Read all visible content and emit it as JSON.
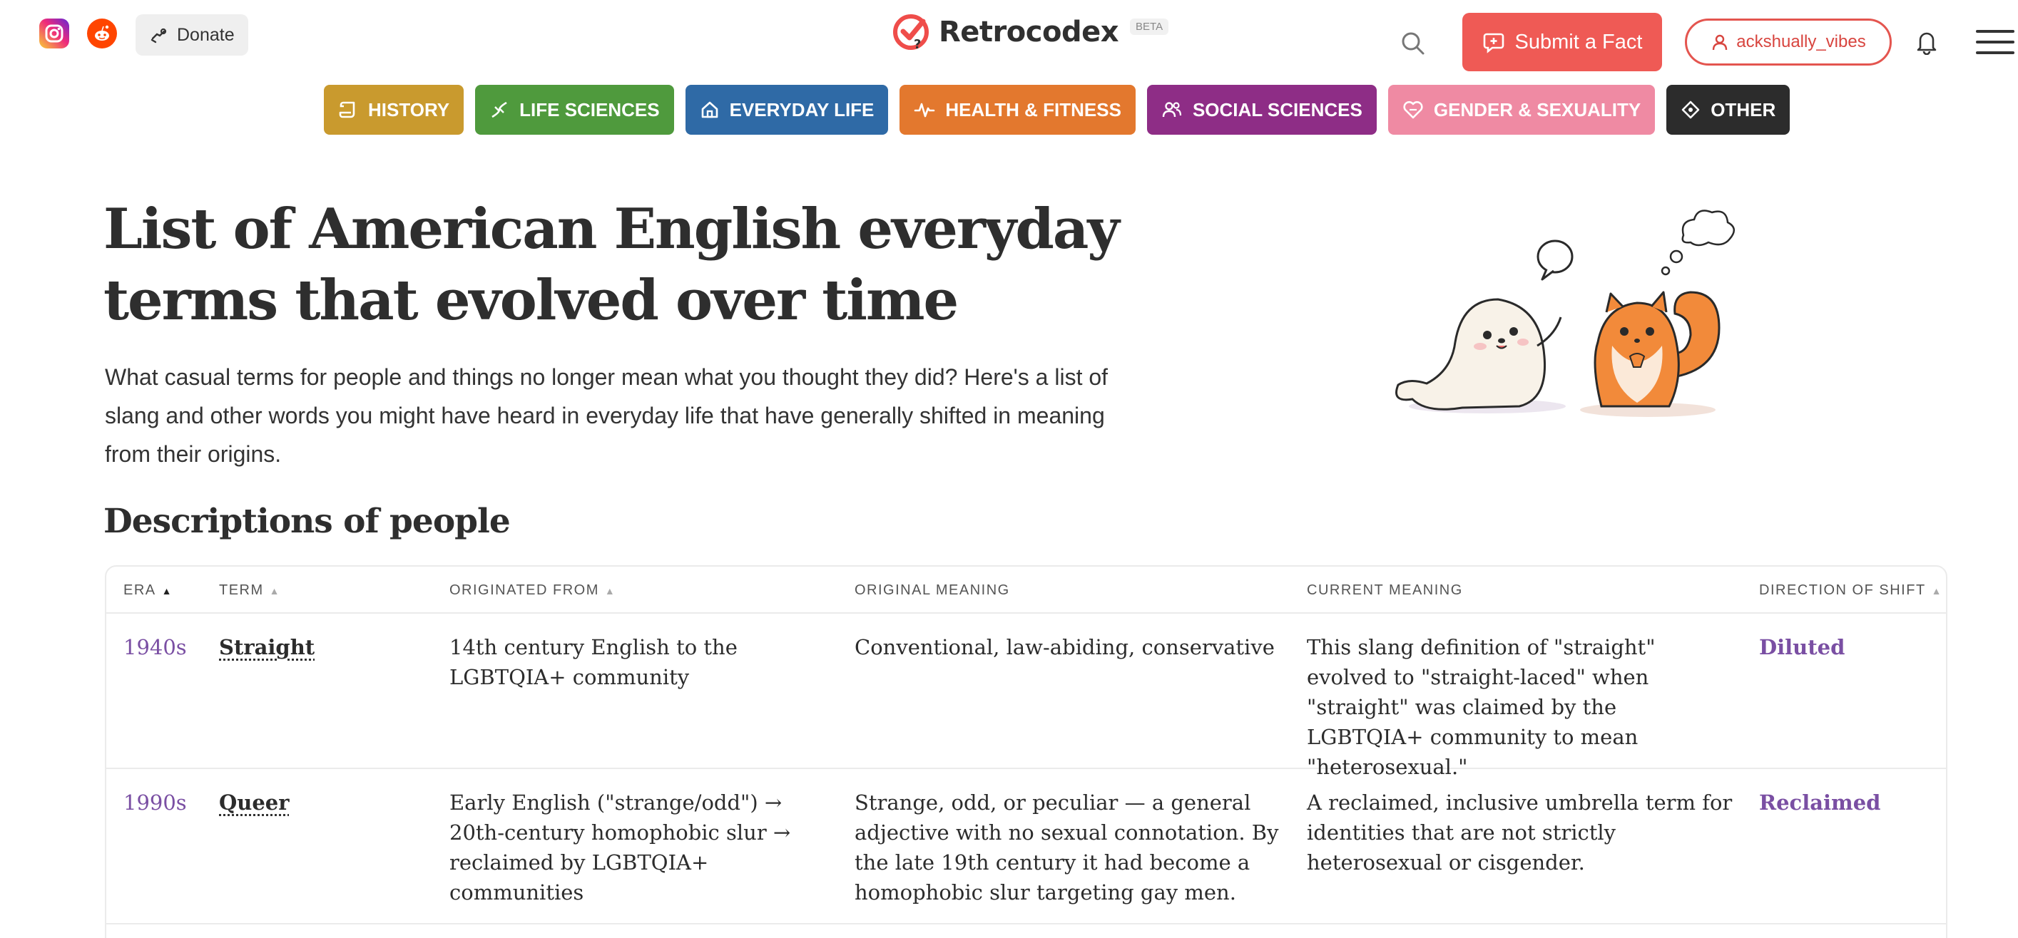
{
  "header": {
    "donate_label": "Donate",
    "logo_text": "Retrocodex",
    "beta_badge": "BETA",
    "submit_label": "Submit a Fact",
    "username": "ackshually_vibes",
    "icons": [
      "instagram-icon",
      "reddit-icon",
      "donate-icon",
      "logo-icon",
      "search-icon",
      "plus-chat-icon",
      "user-icon",
      "bell-icon",
      "menu-icon"
    ]
  },
  "categories": [
    {
      "label": "HISTORY",
      "color": "#c99a2e",
      "icon": "scroll-icon"
    },
    {
      "label": "LIFE SCIENCES",
      "color": "#4f9a3d",
      "icon": "dna-icon"
    },
    {
      "label": "EVERYDAY LIFE",
      "color": "#2f6aa6",
      "icon": "home-icon"
    },
    {
      "label": "HEALTH & FITNESS",
      "color": "#e3782e",
      "icon": "pulse-icon"
    },
    {
      "label": "SOCIAL SCIENCES",
      "color": "#8e2d86",
      "icon": "people-icon"
    },
    {
      "label": "GENDER & SEXUALITY",
      "color": "#ef8aa3",
      "icon": "heart-icon"
    },
    {
      "label": "OTHER",
      "color": "#2c2c2c",
      "icon": "diamond-icon"
    }
  ],
  "page": {
    "title": "List of American English everyday terms that evolved over time",
    "intro": "What casual terms for people and things no longer mean what you thought they did? Here's a list of slang and other words you might have heard in everyday life that have generally shifted in meaning from their origins.",
    "section_heading": "Descriptions of people"
  },
  "table": {
    "columns": [
      "ERA",
      "TERM",
      "ORIGINATED FROM",
      "ORIGINAL MEANING",
      "CURRENT MEANING",
      "DIRECTION OF SHIFT"
    ],
    "rows": [
      {
        "era": "1940s",
        "term": "Straight",
        "origin": "14th century English to the LGBTQIA+ community",
        "original": "Conventional, law-abiding, conservative",
        "current": "This slang definition of \"straight\" evolved to \"straight-laced\" when \"straight\" was claimed by the LGBTQIA+ community to mean \"heterosexual.\"",
        "shift": "Diluted"
      },
      {
        "era": "1990s",
        "term": "Queer",
        "origin": "Early English (\"strange/odd\") → 20th-century homophobic slur → reclaimed by LGBTQIA+ communities",
        "original": "Strange, odd, or peculiar — a general adjective with no sexual connotation. By the late 19th century it had become a homophobic slur targeting gay men.",
        "current": "A reclaimed, inclusive umbrella term for identities that are not strictly heterosexual or cisgender.",
        "shift": "Reclaimed"
      }
    ]
  },
  "colors": {
    "accent": "#ef5a55",
    "link_purple": "#7a4fa3"
  }
}
